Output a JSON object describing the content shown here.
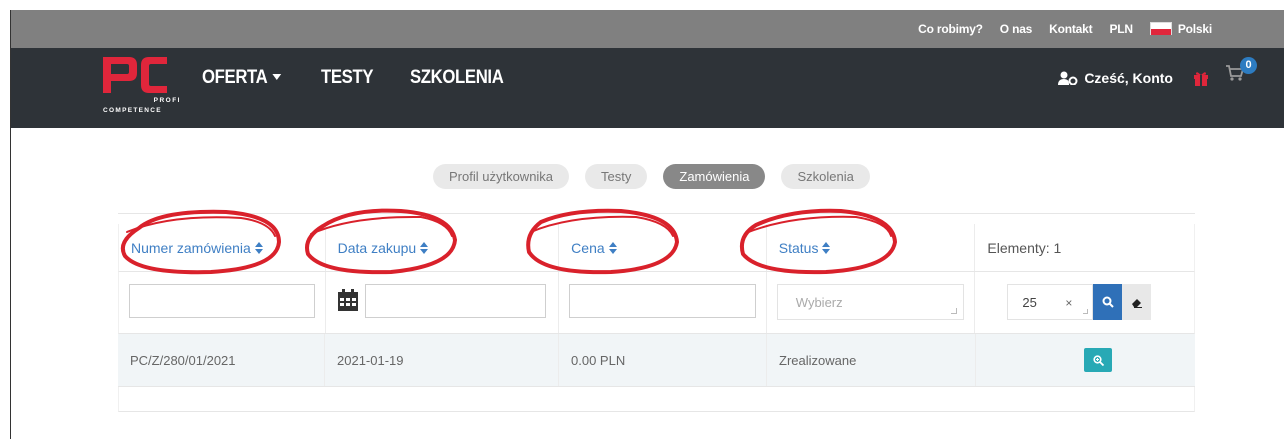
{
  "topbar": {
    "links": [
      "Co robimy?",
      "O nas",
      "Kontakt",
      "PLN"
    ],
    "language": "Polski"
  },
  "logo": {
    "letters": "PC",
    "sub_top": "PROFI",
    "sub_bottom": "COMPETENCE"
  },
  "nav": {
    "items": [
      {
        "label": "OFERTA",
        "has_dropdown": true
      },
      {
        "label": "TESTY"
      },
      {
        "label": "SZKOLENIA"
      }
    ],
    "account_label": "Cześć, Konto",
    "cart_count": "0"
  },
  "tabs": [
    {
      "label": "Profil użytkownika",
      "active": false
    },
    {
      "label": "Testy",
      "active": false
    },
    {
      "label": "Zamówienia",
      "active": true
    },
    {
      "label": "Szkolenia",
      "active": false
    }
  ],
  "table": {
    "columns": [
      "Numer zamówienia",
      "Data zakupu",
      "Cena",
      "Status"
    ],
    "elements_label": "Elementy: 1",
    "status_placeholder": "Wybierz",
    "page_size": "25",
    "rows": [
      [
        "PC/Z/280/01/2021",
        "2021-01-19",
        "0.00 PLN",
        "Zrealizowane"
      ]
    ]
  },
  "colors": {
    "topbar": "#808080",
    "navbar": "#2e3338",
    "brand_red": "#e0263b",
    "link_blue": "#3f7fc4",
    "annotation_red": "#d9212b"
  }
}
